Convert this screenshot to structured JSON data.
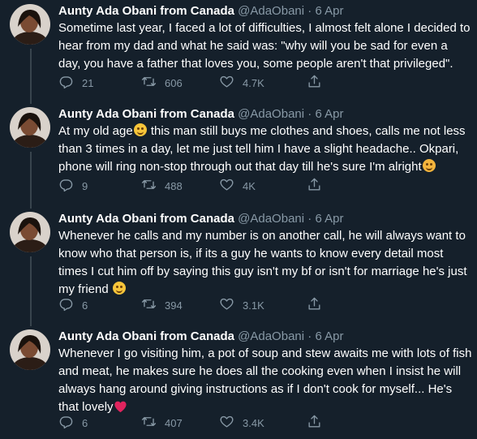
{
  "tweets": [
    {
      "name": "Aunty Ada Obani from Canada",
      "handle": "@AdaObani",
      "sep": "·",
      "date": "6 Apr",
      "text": "Sometime last year, I faced a lot of difficulties, I almost felt alone I decided to hear from my dad and what he said was: \"why will you be sad for even a day, you have a father that loves you, some people aren't that privileged\".",
      "replies": "21",
      "retweets": "606",
      "likes": "4.7K"
    },
    {
      "name": "Aunty Ada Obani from Canada",
      "handle": "@AdaObani",
      "sep": "·",
      "date": "6 Apr",
      "text_a": "At my old age",
      "text_b": " this man still buys me clothes and shoes, calls me not less than 3 times in a day, let me just tell him I have a slight headache.. Okpari, phone will ring non-stop through out that day till he's sure I'm alright",
      "replies": "9",
      "retweets": "488",
      "likes": "4K"
    },
    {
      "name": "Aunty Ada Obani from Canada",
      "handle": "@AdaObani",
      "sep": "·",
      "date": "6 Apr",
      "text": "Whenever he calls and my number is on another call, he will always want to know who that person is, if its a guy he wants to know every detail most times I cut him off by saying this guy isn't my bf or isn't for marriage he's just my friend ",
      "replies": "6",
      "retweets": "394",
      "likes": "3.1K"
    },
    {
      "name": "Aunty Ada Obani from Canada",
      "handle": "@AdaObani",
      "sep": "·",
      "date": "6 Apr",
      "text": "Whenever I go visiting him, a pot of soup and stew awaits me with lots of fish and meat, he makes sure he does all the cooking even when I insist he will always hang around giving instructions as if I don't cook for myself... He's that lovely",
      "replies": "6",
      "retweets": "407",
      "likes": "3.4K"
    }
  ],
  "icons": {
    "reply": "reply-icon",
    "retweet": "retweet-icon",
    "like": "like-icon",
    "share": "share-icon"
  },
  "colors": {
    "background": "#15202b",
    "secondary_text": "#8899a6",
    "thread_line": "#38444d",
    "heart": "#e0245e"
  }
}
